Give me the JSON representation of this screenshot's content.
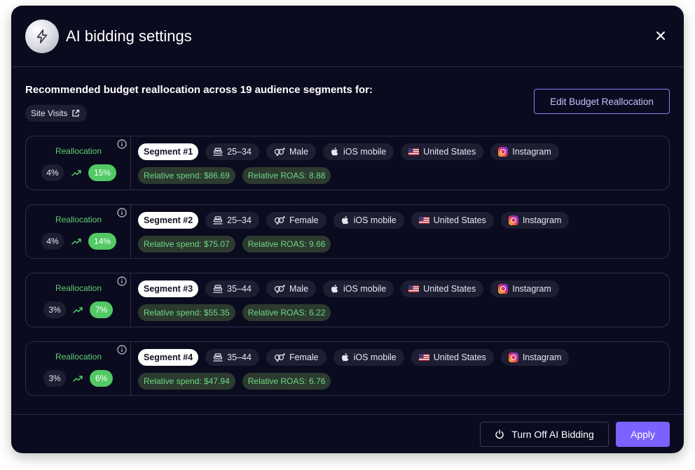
{
  "modal": {
    "title": "AI bidding settings",
    "intro": "Recommended budget reallocation across 19 audience segments for:",
    "site_chip": "Site Visits",
    "edit_button": "Edit Budget Reallocation"
  },
  "segments": [
    {
      "label": "Segment #1",
      "realloc_label": "Reallocation",
      "from": "4%",
      "to": "15%",
      "age": "25–34",
      "gender": "Male",
      "device": "iOS mobile",
      "country": "United States",
      "platform": "Instagram",
      "spend": "Relative spend: $86.69",
      "roas": "Relative ROAS: 8.88"
    },
    {
      "label": "Segment #2",
      "realloc_label": "Reallocation",
      "from": "4%",
      "to": "14%",
      "age": "25–34",
      "gender": "Female",
      "device": "iOS mobile",
      "country": "United States",
      "platform": "Instagram",
      "spend": "Relative spend: $75.07",
      "roas": "Relative ROAS: 9.66"
    },
    {
      "label": "Segment #3",
      "realloc_label": "Reallocation",
      "from": "3%",
      "to": "7%",
      "age": "35–44",
      "gender": "Male",
      "device": "iOS mobile",
      "country": "United States",
      "platform": "Instagram",
      "spend": "Relative spend: $55.35",
      "roas": "Relative ROAS: 6.22"
    },
    {
      "label": "Segment #4",
      "realloc_label": "Reallocation",
      "from": "3%",
      "to": "6%",
      "age": "35–44",
      "gender": "Female",
      "device": "iOS mobile",
      "country": "United States",
      "platform": "Instagram",
      "spend": "Relative spend: $47.94",
      "roas": "Relative ROAS: 6.76"
    }
  ],
  "footer": {
    "turn_off": "Turn Off AI Bidding",
    "apply": "Apply"
  },
  "colors": {
    "background": "#0b0b1f",
    "accent": "#7b61ff",
    "positive": "#52c964"
  }
}
